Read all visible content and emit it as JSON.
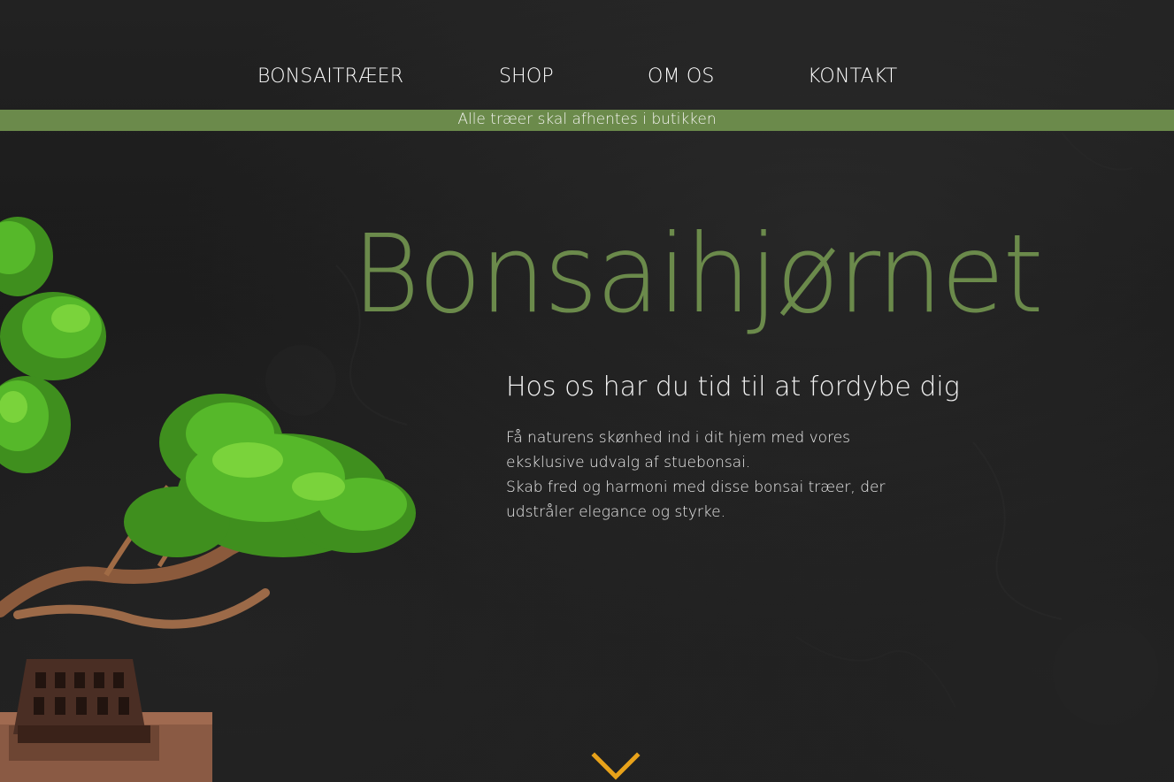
{
  "nav": {
    "items": [
      {
        "label": "BONSAITRÆER"
      },
      {
        "label": "SHOP"
      },
      {
        "label": "OM OS"
      },
      {
        "label": "KONTAKT"
      }
    ]
  },
  "notice": {
    "text": "Alle træer skal afhentes i butikken"
  },
  "hero": {
    "title": "Bonsaihjørnet",
    "subtitle": "Hos os har du tid til at fordybe dig",
    "body": [
      "Få naturens skønhed ind i dit hjem med vores eksklusive udvalg af stuebonsai.",
      "Skab fred og harmoni med disse bonsai træer, der udstråler elegance og styrke."
    ]
  },
  "colors": {
    "accent_green": "#6b8a4b",
    "background": "#1c1c1c",
    "chevron": "#e8a21a"
  },
  "icons": {
    "scroll": "chevron-down-icon",
    "decor": "bonsai-tree-image"
  }
}
